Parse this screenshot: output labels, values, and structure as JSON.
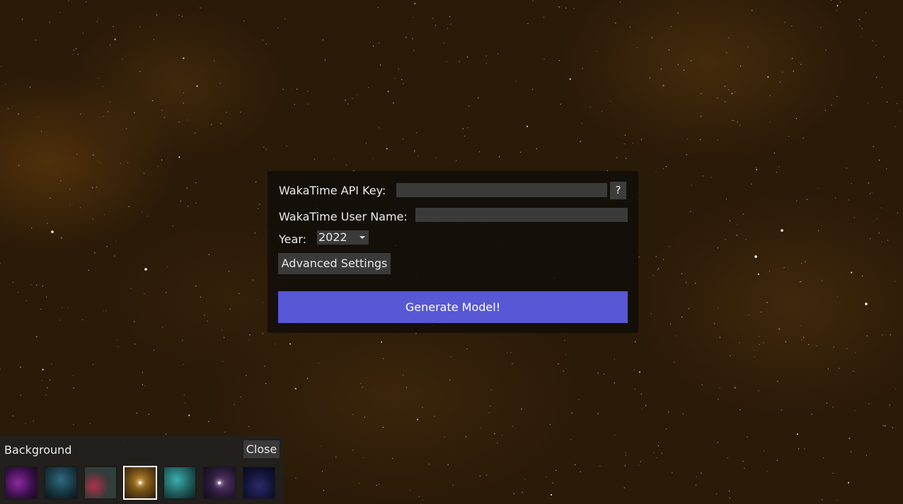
{
  "form": {
    "api_key_label": "WakaTime API Key:",
    "api_key_value": "",
    "help_label": "?",
    "username_label": "WakaTime User Name:",
    "username_value": "",
    "year_label": "Year:",
    "year_value": "2022",
    "advanced_label": "Advanced Settings",
    "generate_label": "Generate Model!",
    "accent_color": "#5857d6"
  },
  "background_picker": {
    "title": "Background",
    "close_label": "Close",
    "selected_index": 3,
    "thumbnails": [
      {
        "name": "purple-nebula",
        "color": "#5a1f6e"
      },
      {
        "name": "teal-nebula",
        "color": "#1f4a5a"
      },
      {
        "name": "red-green-nebula",
        "color": "#4a3a3a"
      },
      {
        "name": "orange-nebula",
        "color": "#6b4a16"
      },
      {
        "name": "cyan-nebula",
        "color": "#1f6a6a"
      },
      {
        "name": "violet-star",
        "color": "#3a2a4a"
      },
      {
        "name": "dark-blue-nebula",
        "color": "#1a1a3a"
      }
    ]
  }
}
